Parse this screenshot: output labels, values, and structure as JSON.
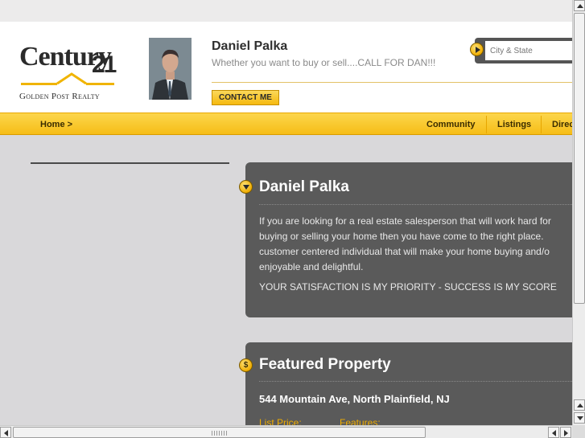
{
  "brand": {
    "logo_word": "Century",
    "logo_number": "21",
    "logo_subtitle": "Golden Post Realty"
  },
  "agent": {
    "name": "Daniel Palka",
    "tagline": "Whether you want to buy or sell....CALL FOR DAN!!!",
    "contact_label": "CONTACT ME"
  },
  "search": {
    "placeholder": "City & State"
  },
  "nav": {
    "home": "Home >",
    "items": [
      "Community",
      "Listings",
      "Direc"
    ]
  },
  "about": {
    "title": "Daniel Palka",
    "lines": [
      "If you are looking for a real estate salesperson that will work hard for",
      "buying or selling your home then you have come to the right place.",
      "customer centered individual that will make your home buying and/o",
      "enjoyable and delightful."
    ],
    "motto": "YOUR SATISFACTION IS MY PRIORITY - SUCCESS IS MY SCORE"
  },
  "featured": {
    "icon_glyph": "$",
    "title": "Featured Property",
    "address": "544 Mountain Ave, North Plainfield, NJ",
    "list_price_label": "List Price:",
    "features_label": "Features:"
  },
  "colors": {
    "accent_gold": "#f6bd17",
    "panel_gray": "#5a5a5a",
    "page_bg": "#d9d8da"
  }
}
